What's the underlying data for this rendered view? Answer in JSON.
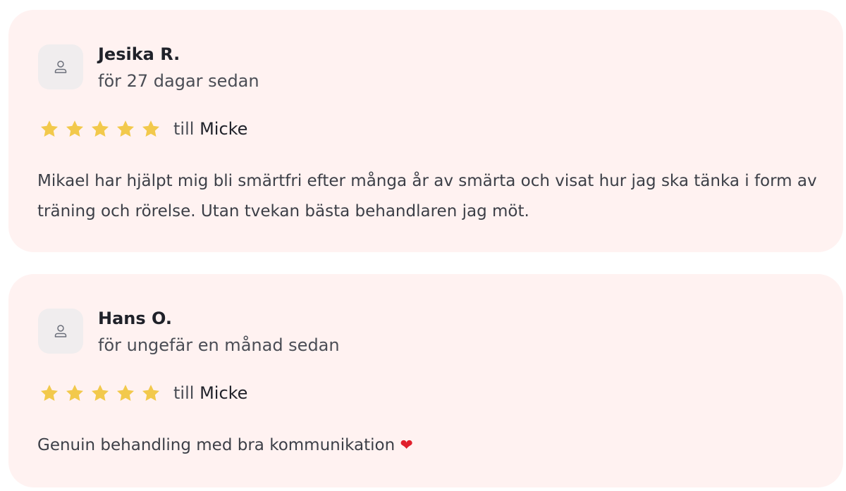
{
  "reviews": [
    {
      "author": "Jesika R.",
      "time": "för 27 dagar sedan",
      "stars": 5,
      "target_prefix": "till",
      "target_name": "Micke",
      "text": "Mikael har hjälpt mig bli smärtfri efter många år av smärta och visat hur jag ska tänka i form av träning och rörelse. Utan tvekan bästa behandlaren jag möt.",
      "emoji": ""
    },
    {
      "author": "Hans O.",
      "time": "för ungefär en månad sedan",
      "stars": 5,
      "target_prefix": "till",
      "target_name": "Micke",
      "text": "Genuin behandling med bra kommunikation",
      "emoji": "❤"
    }
  ],
  "colors": {
    "card_background": "#fff2f1",
    "star": "#f2c94c",
    "heart": "#e0202c"
  },
  "icons": {
    "avatar": "user-icon",
    "rating": "star-icon",
    "emoji": "heart-icon"
  }
}
